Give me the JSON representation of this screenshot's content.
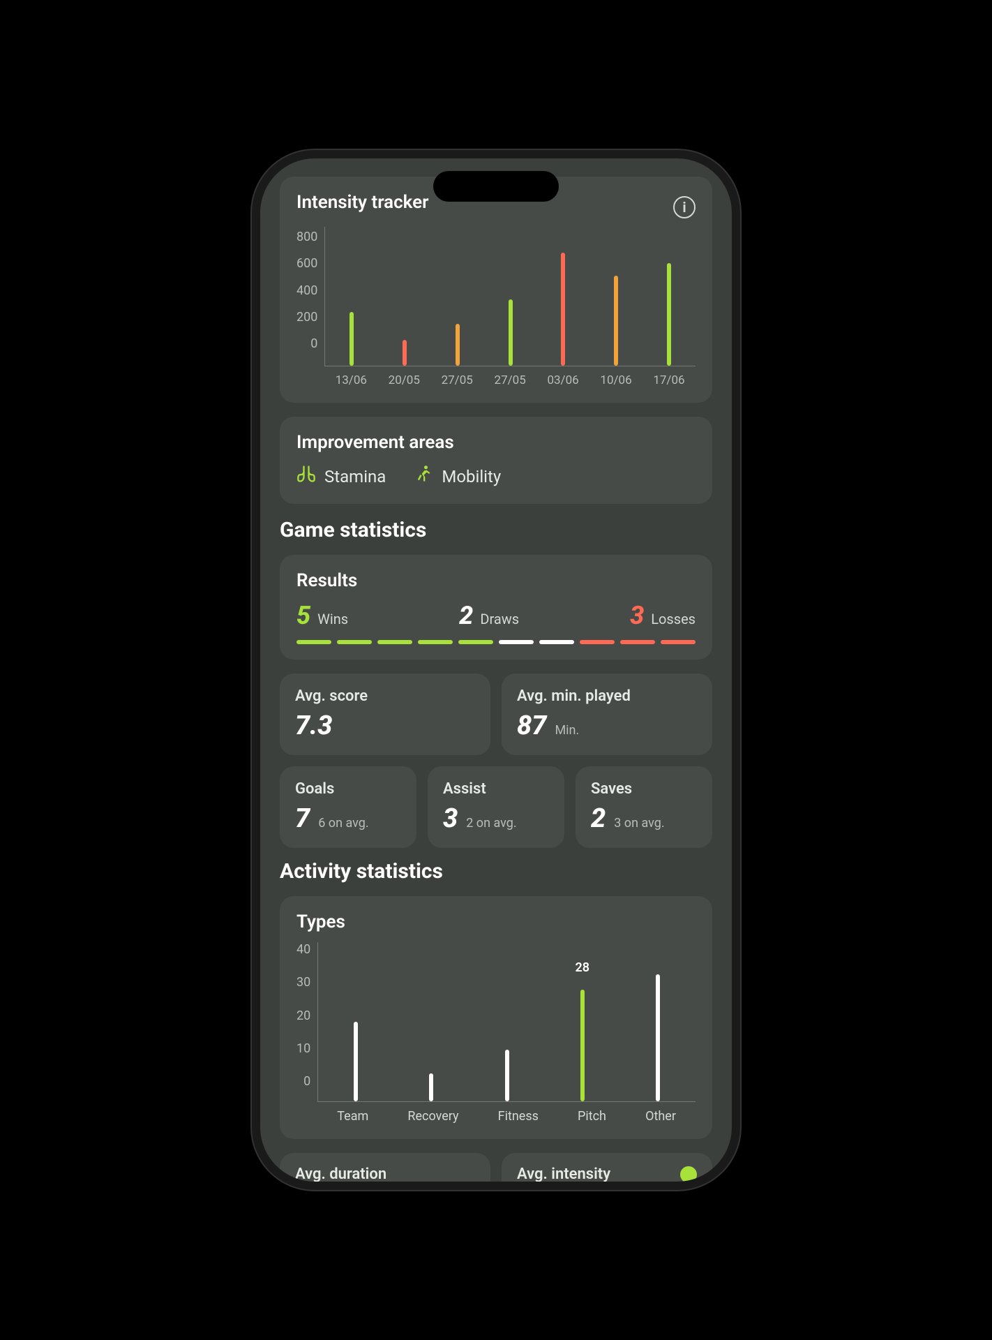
{
  "intensity": {
    "title": "Intensity tracker",
    "info_label": "i"
  },
  "improvement": {
    "title": "Improvement areas",
    "items": [
      {
        "icon": "lungs-icon",
        "label": "Stamina"
      },
      {
        "icon": "runner-icon",
        "label": "Mobility"
      }
    ]
  },
  "game_stats": {
    "section_title": "Game statistics",
    "results": {
      "title": "Results",
      "wins": {
        "value": "5",
        "label": "Wins"
      },
      "draws": {
        "value": "2",
        "label": "Draws"
      },
      "losses": {
        "value": "3",
        "label": "Losses"
      }
    },
    "avg_score": {
      "title": "Avg. score",
      "value": "7.3"
    },
    "avg_min": {
      "title": "Avg. min. played",
      "value": "87",
      "unit": "Min."
    },
    "goals": {
      "title": "Goals",
      "value": "7",
      "sub": "6 on avg."
    },
    "assist": {
      "title": "Assist",
      "value": "3",
      "sub": "2 on avg."
    },
    "saves": {
      "title": "Saves",
      "value": "2",
      "sub": "3 on avg."
    }
  },
  "activity": {
    "section_title": "Activity statistics",
    "types_title": "Types",
    "highlight_value": "28",
    "cutoff_left": "Avg. duration",
    "cutoff_right": "Avg. intensity"
  },
  "chart_data": [
    {
      "id": "intensity_tracker",
      "type": "bar",
      "title": "Intensity tracker",
      "xlabel": "",
      "ylabel": "",
      "ylim": [
        0,
        800
      ],
      "y_ticks": [
        800,
        600,
        400,
        200,
        0
      ],
      "categories": [
        "13/06",
        "20/05",
        "27/05",
        "27/05",
        "03/06",
        "10/06",
        "17/06"
      ],
      "values": [
        310,
        150,
        240,
        380,
        650,
        520,
        590
      ],
      "bar_colors": [
        "#a7e13a",
        "#ff6a54",
        "#f2a33a",
        "#a7e13a",
        "#ff6a54",
        "#f2a33a",
        "#a7e13a"
      ]
    },
    {
      "id": "activity_types",
      "type": "bar",
      "title": "Types",
      "xlabel": "",
      "ylabel": "",
      "ylim": [
        0,
        40
      ],
      "y_ticks": [
        40,
        30,
        20,
        10,
        0
      ],
      "categories": [
        "Team",
        "Recovery",
        "Fitness",
        "Pitch",
        "Other"
      ],
      "values": [
        20,
        7,
        13,
        28,
        32
      ],
      "highlight_index": 3
    }
  ]
}
